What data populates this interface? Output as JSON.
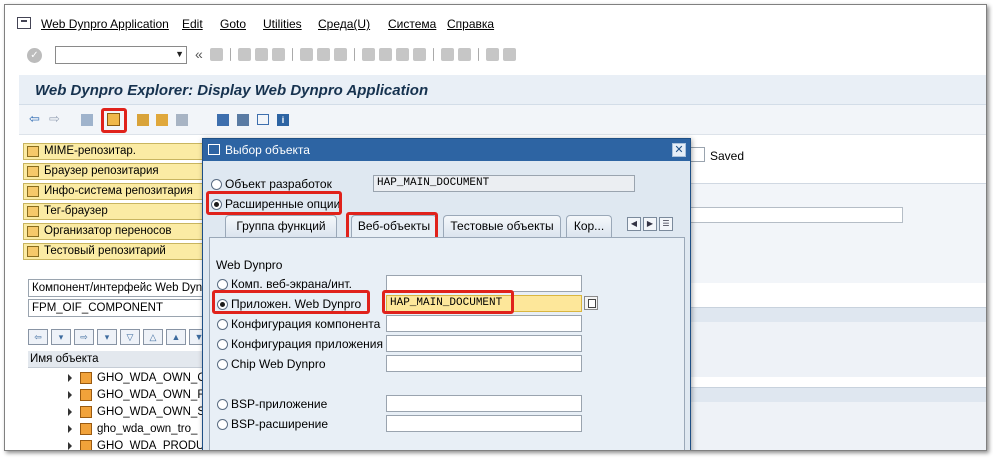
{
  "menubar": {
    "items": [
      "Web Dynpro Application",
      "Edit",
      "Goto",
      "Utilities",
      "Среда(U)",
      "Система",
      "Справка"
    ]
  },
  "title": "Web Dynpro Explorer: Display Web Dynpro Application",
  "left_panel": {
    "nav_buttons": [
      "MIME-репозитар.",
      "Браузер репозитария",
      "Инфо-система репозитария",
      "Тег-браузер",
      "Организатор переносов",
      "Тестовый репозитарий"
    ],
    "object_type": "Компонент/интерфейс Web Dynpro",
    "object_name": "FPM_OIF_COMPONENT",
    "tree_header": "Имя объекта",
    "tree_rows": [
      "GHO_WDA_OWN_O",
      "GHO_WDA_OWN_R",
      "GHO_WDA_OWN_SI",
      "gho_wda_own_tro_",
      "GHO_WDA_PRODUC"
    ]
  },
  "background": {
    "saved_label": "Saved"
  },
  "dialog": {
    "title": "Выбор объекта",
    "close": "✕",
    "radio_dev_object": "Объект разработок",
    "dev_object_value": "HAP_MAIN_DOCUMENT",
    "radio_extended": "Расширенные опции",
    "tabs": [
      "Группа функций",
      "Веб-объекты",
      "Тестовые объекты",
      "Кор..."
    ],
    "section_title": "Web Dynpro",
    "options": [
      {
        "label": "Комп. веб-экрана/инт.",
        "value": ""
      },
      {
        "label": "Приложен. Web Dynpro",
        "value": "HAP_MAIN_DOCUMENT"
      },
      {
        "label": "Конфигурация компонента",
        "value": ""
      },
      {
        "label": "Конфигурация приложения",
        "value": ""
      },
      {
        "label": "Chip Web Dynpro",
        "value": ""
      },
      {
        "label": "BSP-приложение",
        "value": ""
      },
      {
        "label": "BSP-расширение",
        "value": ""
      }
    ]
  },
  "colors": {
    "highlight": "#e0221b",
    "title_text": "#16324f",
    "dialog_header": "#2d64a3",
    "nav_button": "#fbeba4",
    "active_field": "#fde79a"
  }
}
